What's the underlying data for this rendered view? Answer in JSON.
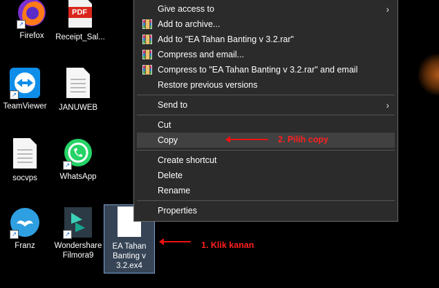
{
  "desktop": {
    "icons": [
      {
        "label": "Firefox",
        "icon": "firefox-icon"
      },
      {
        "label": "Receipt_Sal...",
        "icon": "pdf-icon"
      },
      {
        "label": "TeamViewer",
        "icon": "teamviewer-icon"
      },
      {
        "label": "JANUWEB",
        "icon": "document-icon"
      },
      {
        "label": "socvps",
        "icon": "document-icon"
      },
      {
        "label": "WhatsApp",
        "icon": "whatsapp-icon"
      },
      {
        "label": "Franz",
        "icon": "franz-icon"
      },
      {
        "label": "Wondershare\nFilmora9",
        "icon": "filmora-icon"
      }
    ],
    "selected_file": {
      "label": "EA Tahan\nBanting v\n3.2.ex4",
      "icon": "document-icon"
    },
    "pdf_badge": "PDF"
  },
  "context_menu": {
    "items": [
      {
        "label": "Give access to",
        "submenu": true
      },
      {
        "label": "Add to archive...",
        "icon": "winrar-icon"
      },
      {
        "label": "Add to \"EA Tahan Banting v 3.2.rar\"",
        "icon": "winrar-icon"
      },
      {
        "label": "Compress and email...",
        "icon": "winrar-icon"
      },
      {
        "label": "Compress to \"EA Tahan Banting v 3.2.rar\" and email",
        "icon": "winrar-icon"
      },
      {
        "label": "Restore previous versions"
      },
      {
        "label": "Send to",
        "submenu": true
      },
      {
        "label": "Cut"
      },
      {
        "label": "Copy",
        "highlighted": true
      },
      {
        "label": "Create shortcut"
      },
      {
        "label": "Delete"
      },
      {
        "label": "Rename"
      },
      {
        "label": "Properties"
      }
    ]
  },
  "annotations": {
    "step1": "1. Klik kanan",
    "step2": "2. Pilih copy",
    "color": "#ff1f1f"
  }
}
